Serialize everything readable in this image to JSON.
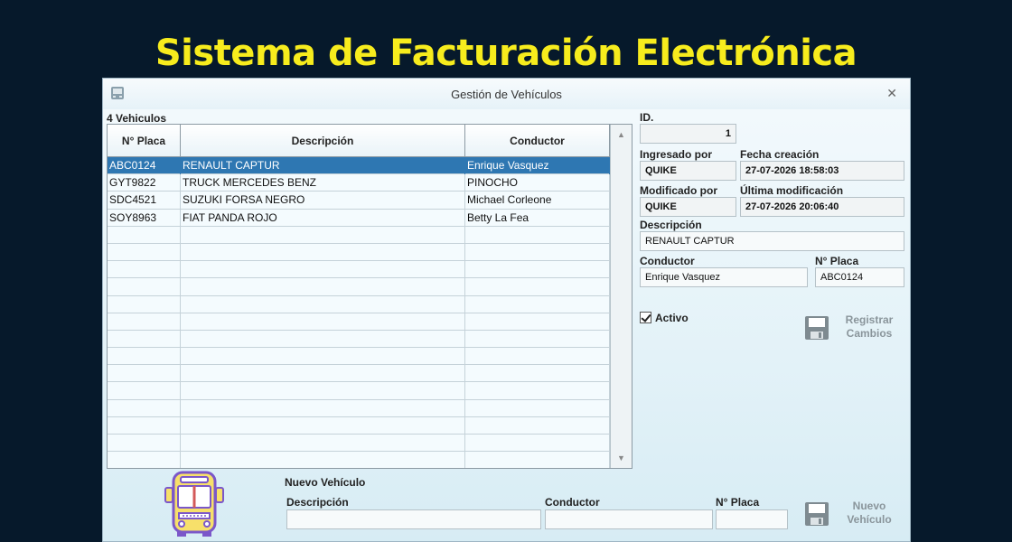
{
  "page": {
    "title": "Sistema de Facturación Electrónica"
  },
  "window": {
    "title": "Gestión de Vehículos",
    "close_glyph": "✕"
  },
  "list": {
    "count_label": "4 Vehiculos",
    "columns": [
      "N° Placa",
      "Descripción",
      "Conductor"
    ],
    "rows": [
      {
        "placa": "ABC0124",
        "descripcion": "RENAULT CAPTUR",
        "conductor": "Enrique Vasquez",
        "selected": true
      },
      {
        "placa": "GYT9822",
        "descripcion": "TRUCK MERCEDES BENZ",
        "conductor": "PINOCHO"
      },
      {
        "placa": "SDC4521",
        "descripcion": "SUZUKI FORSA NEGRO",
        "conductor": "Michael Corleone"
      },
      {
        "placa": "SOY8963",
        "descripcion": "FIAT PANDA ROJO",
        "conductor": "Betty La Fea"
      }
    ]
  },
  "detail": {
    "id_label": "ID.",
    "id_value": "1",
    "ingresado_label": "Ingresado por",
    "ingresado_value": "QUIKE",
    "fecha_creacion_label": "Fecha creación",
    "fecha_creacion_value": "27-07-2026 18:58:03",
    "modificado_label": "Modificado por",
    "modificado_value": "QUIKE",
    "ultima_mod_label": "Última modificación",
    "ultima_mod_value": "27-07-2026 20:06:40",
    "descripcion_label": "Descripción",
    "descripcion_value": "RENAULT CAPTUR",
    "conductor_label": "Conductor",
    "conductor_value": "Enrique Vasquez",
    "placa_label": "N° Placa",
    "placa_value": "ABC0124",
    "activo_label": "Activo",
    "activo_checked": true,
    "save_line1": "Registrar",
    "save_line2": "Cambios"
  },
  "new_vehicle": {
    "title": "Nuevo Vehículo",
    "descripcion_label": "Descripción",
    "descripcion_value": "",
    "conductor_label": "Conductor",
    "conductor_value": "",
    "placa_label": "N° Placa",
    "placa_value": "",
    "btn_line1": "Nuevo",
    "btn_line2": "Vehículo"
  },
  "colors": {
    "title": "#f7ec1d",
    "background": "#06192b",
    "selection": "#2e77b2",
    "bus_yellow": "#f7e06a",
    "bus_outline": "#7b57c9"
  },
  "icons": [
    "app-window-icon",
    "close-icon",
    "scroll-up-icon",
    "scroll-down-icon",
    "floppy-disk-icon",
    "bus-icon"
  ]
}
